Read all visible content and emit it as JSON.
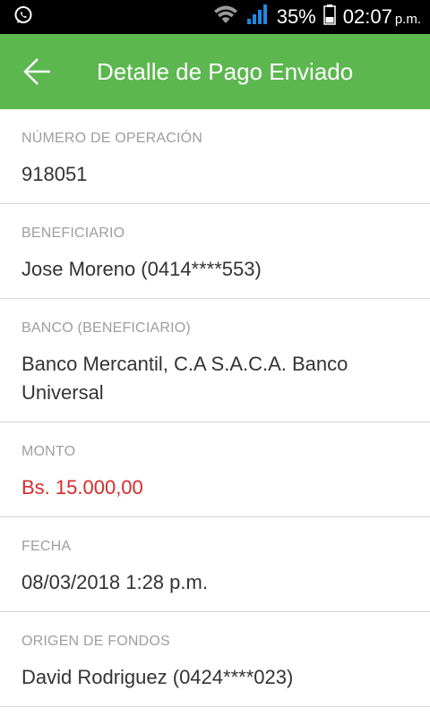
{
  "status_bar": {
    "battery": "35%",
    "time": "02:07",
    "ampm": "p.m."
  },
  "app_bar": {
    "title": "Detalle de Pago Enviado"
  },
  "details": [
    {
      "label": "NÚMERO DE OPERACIÓN",
      "value": "918051"
    },
    {
      "label": "BENEFICIARIO",
      "value": "Jose Moreno (0414****553)"
    },
    {
      "label": "BANCO (BENEFICIARIO)",
      "value": "Banco Mercantil, C.A S.A.C.A. Banco Universal"
    },
    {
      "label": "MONTO",
      "value": "Bs. 15.000,00"
    },
    {
      "label": "FECHA",
      "value": "08/03/2018 1:28 p.m."
    },
    {
      "label": "ORIGEN DE FONDOS",
      "value": "David Rodriguez (0424****023)"
    }
  ],
  "colors": {
    "app_bar": "#5cb74f",
    "amount": "#d82a2a",
    "label": "#9e9e9e"
  }
}
